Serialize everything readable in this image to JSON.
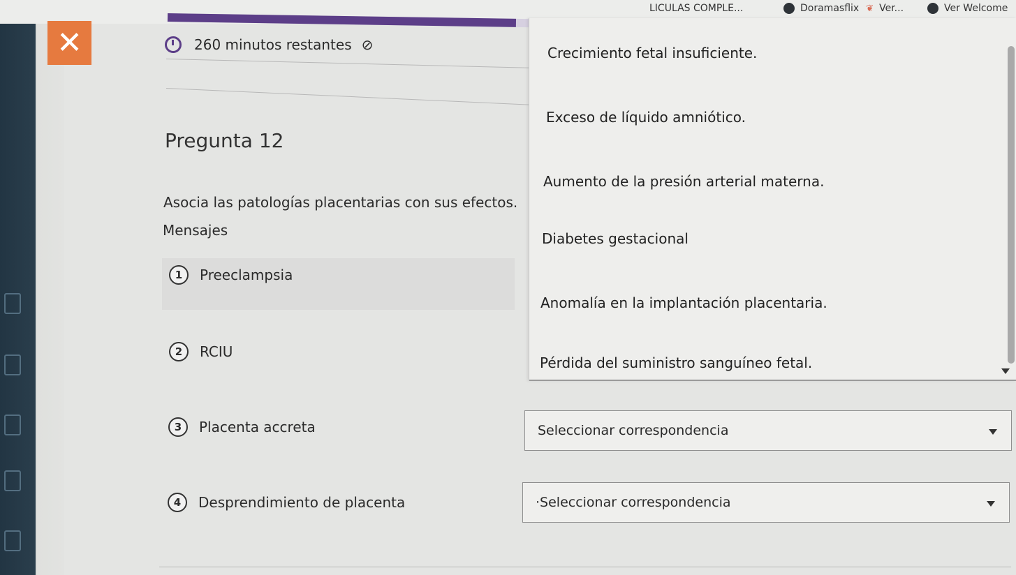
{
  "browser": {
    "bookmarks": [
      {
        "label": "LICULAS COMPLE..."
      },
      {
        "label": "Doramasflix"
      },
      {
        "label": "Ver..."
      },
      {
        "label": "Ver Welcome"
      }
    ]
  },
  "quiz": {
    "progress_fraction": 0.95,
    "timer_text": "260 minutos restantes",
    "question_title": "Pregunta 12",
    "question_text": "Asocia las patologías placentarias con sus efectos.",
    "messages_label": "Mensajes",
    "items": [
      {
        "num": "1",
        "label": "Preeclampsia"
      },
      {
        "num": "2",
        "label": "RCIU"
      },
      {
        "num": "3",
        "label": "Placenta accreta"
      },
      {
        "num": "4",
        "label": "Desprendimiento de placenta"
      }
    ],
    "dropdown_options": [
      "Crecimiento fetal insuficiente.",
      "Exceso de líquido amniótico.",
      "Aumento de la presión arterial materna.",
      "Diabetes gestacional",
      "Anomalía en la implantación placentaria.",
      "Pérdida del suministro sanguíneo fetal."
    ],
    "select_placeholder_3": "Seleccionar correspondencia",
    "select_placeholder_4": "·Seleccionar correspondencia"
  },
  "colors": {
    "accent": "#5c3e88",
    "close_button": "#e67a3f"
  }
}
